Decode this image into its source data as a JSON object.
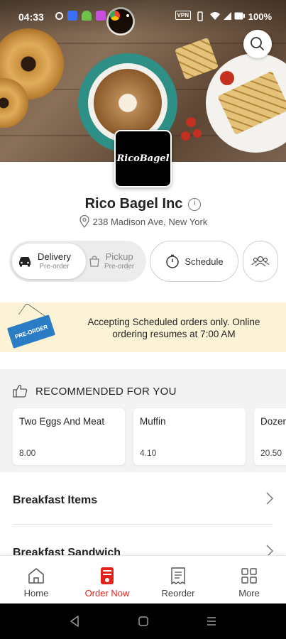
{
  "status_bar": {
    "time": "04:33",
    "vpn": "VPN",
    "battery": "100%"
  },
  "store": {
    "logo_text": "RicoBagel",
    "name": "Rico Bagel Inc",
    "address": "238 Madison Ave, New York"
  },
  "order_mode": {
    "delivery_label": "Delivery",
    "delivery_sub": "Pre-order",
    "pickup_label": "Pickup",
    "pickup_sub": "Pre-order",
    "schedule_label": "Schedule"
  },
  "banner": {
    "sign_text": "PRE-ORDER",
    "message": "Accepting Scheduled orders only. Online ordering resumes at 7:00 AM"
  },
  "recommended": {
    "title": "RECOMMENDED FOR YOU",
    "items": [
      {
        "name": "Two Eggs And Meat",
        "price": "8.00"
      },
      {
        "name": "Muffin",
        "price": "4.10"
      },
      {
        "name": "Dozen",
        "price": "20.50"
      }
    ]
  },
  "categories": [
    {
      "label": "Breakfast Items"
    },
    {
      "label": "Breakfast Sandwich"
    }
  ],
  "bottom_nav": {
    "home": "Home",
    "order_now": "Order Now",
    "reorder": "Reorder",
    "more": "More"
  },
  "colors": {
    "accent": "#e2231a",
    "banner_bg": "#fcf2d6",
    "section_bg": "#f3f3f3"
  }
}
